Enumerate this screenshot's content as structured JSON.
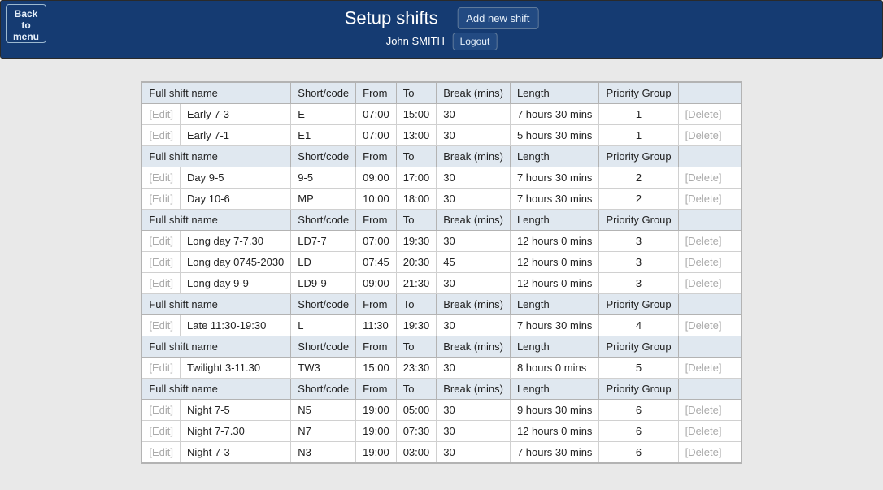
{
  "header": {
    "back_label": "Back to menu",
    "title": "Setup shifts",
    "add_label": "Add new shift",
    "user_name": "John SMITH",
    "logout_label": "Logout"
  },
  "columns": {
    "name": "Full shift name",
    "code": "Short/code",
    "from": "From",
    "to": "To",
    "break": "Break (mins)",
    "length": "Length",
    "priority": "Priority Group"
  },
  "labels": {
    "edit": "Edit",
    "delete": "Delete"
  },
  "groups": [
    {
      "rows": [
        {
          "name": "Early 7-3",
          "code": "E",
          "from": "07:00",
          "to": "15:00",
          "break": "30",
          "length": "7 hours 30 mins",
          "priority": "1"
        },
        {
          "name": "Early 7-1",
          "code": "E1",
          "from": "07:00",
          "to": "13:00",
          "break": "30",
          "length": "5 hours 30 mins",
          "priority": "1"
        }
      ]
    },
    {
      "rows": [
        {
          "name": "Day 9-5",
          "code": "9-5",
          "from": "09:00",
          "to": "17:00",
          "break": "30",
          "length": "7 hours 30 mins",
          "priority": "2"
        },
        {
          "name": "Day 10-6",
          "code": "MP",
          "from": "10:00",
          "to": "18:00",
          "break": "30",
          "length": "7 hours 30 mins",
          "priority": "2"
        }
      ]
    },
    {
      "rows": [
        {
          "name": "Long day 7-7.30",
          "code": "LD7-7",
          "from": "07:00",
          "to": "19:30",
          "break": "30",
          "length": "12 hours 0 mins",
          "priority": "3"
        },
        {
          "name": "Long day 0745-2030",
          "code": "LD",
          "from": "07:45",
          "to": "20:30",
          "break": "45",
          "length": "12 hours 0 mins",
          "priority": "3"
        },
        {
          "name": "Long day 9-9",
          "code": "LD9-9",
          "from": "09:00",
          "to": "21:30",
          "break": "30",
          "length": "12 hours 0 mins",
          "priority": "3"
        }
      ]
    },
    {
      "rows": [
        {
          "name": "Late 11:30-19:30",
          "code": "L",
          "from": "11:30",
          "to": "19:30",
          "break": "30",
          "length": "7 hours 30 mins",
          "priority": "4"
        }
      ]
    },
    {
      "rows": [
        {
          "name": "Twilight 3-11.30",
          "code": "TW3",
          "from": "15:00",
          "to": "23:30",
          "break": "30",
          "length": " 8 hours 0 mins",
          "priority": "5"
        }
      ]
    },
    {
      "rows": [
        {
          "name": "Night 7-5",
          "code": "N5",
          "from": "19:00",
          "to": "05:00",
          "break": "30",
          "length": "9 hours 30 mins",
          "priority": "6"
        },
        {
          "name": "Night 7-7.30",
          "code": "N7",
          "from": "19:00",
          "to": "07:30",
          "break": "30",
          "length": "12 hours 0 mins",
          "priority": "6"
        },
        {
          "name": "Night 7-3",
          "code": "N3",
          "from": "19:00",
          "to": "03:00",
          "break": "30",
          "length": "7 hours 30 mins",
          "priority": "6"
        }
      ]
    }
  ]
}
